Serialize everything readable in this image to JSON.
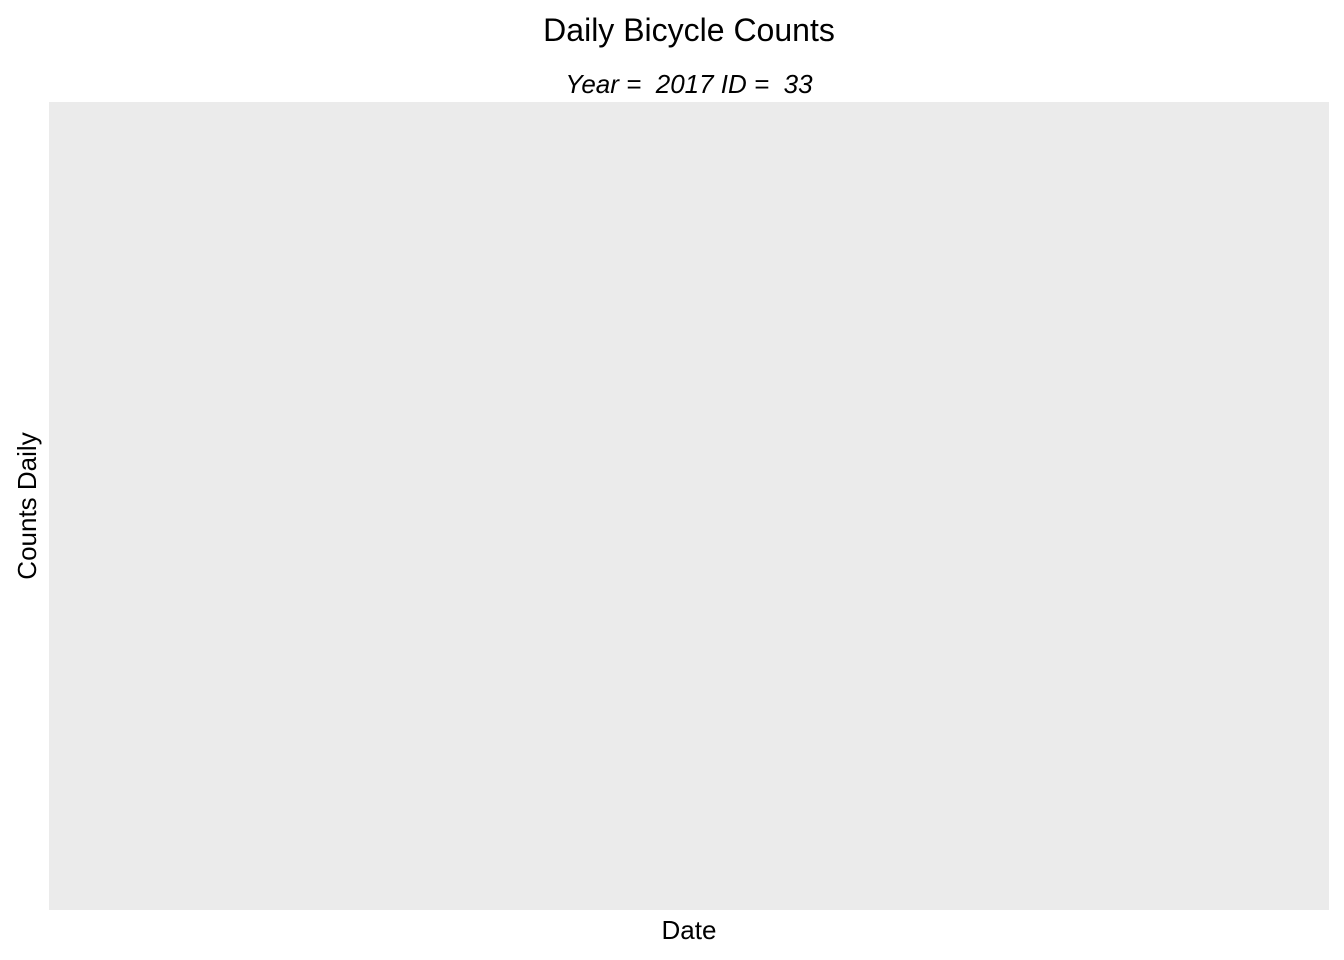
{
  "chart_data": {
    "type": "line",
    "title": "Daily Bicycle Counts",
    "subtitle": "Year =  2017 ID =  33",
    "xlabel": "Date",
    "ylabel": "Counts Daily",
    "series": [],
    "grid": false,
    "legend": "none",
    "colors": {
      "panel_background": "#EBEBEB",
      "page_background": "#FFFFFF",
      "text": "#000000"
    }
  }
}
